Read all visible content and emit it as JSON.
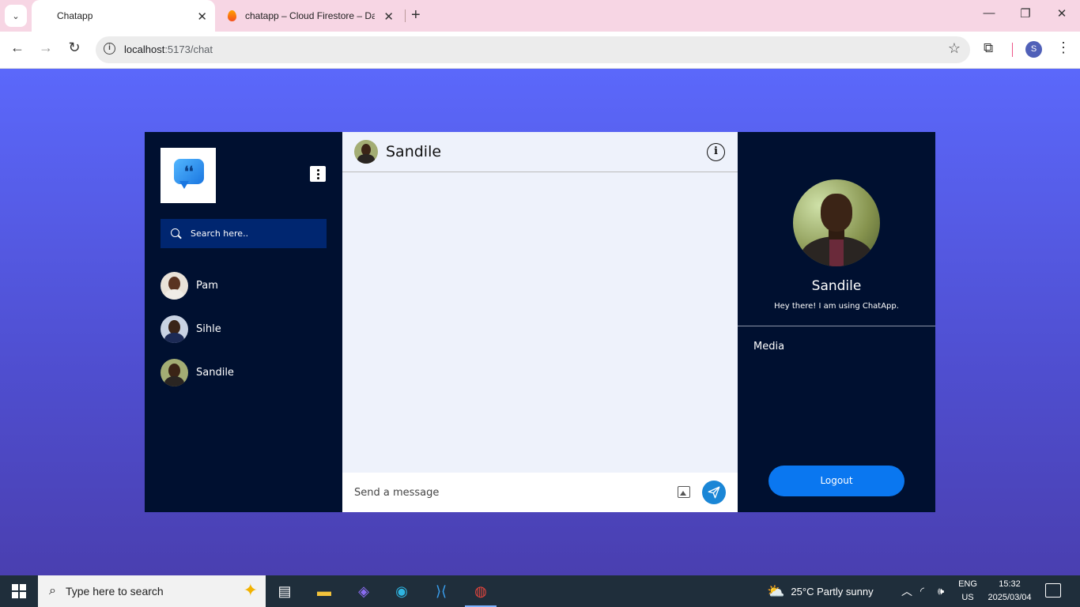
{
  "browser": {
    "tabs": [
      {
        "title": "Chatapp",
        "active": true
      },
      {
        "title": "chatapp – Cloud Firestore – Dat",
        "active": false
      }
    ],
    "url_host": "localhost",
    "url_port_path": ":5173/chat",
    "profile_initial": "S"
  },
  "sidebar": {
    "search_placeholder": "Search here..",
    "contacts": [
      {
        "name": "Pam"
      },
      {
        "name": "Sihle"
      },
      {
        "name": "Sandile"
      }
    ]
  },
  "chat": {
    "title": "Sandile",
    "message_placeholder": "Send a message"
  },
  "profile": {
    "name": "Sandile",
    "bio": "Hey there! I am using ChatApp.",
    "media_label": "Media",
    "logout_label": "Logout"
  },
  "taskbar": {
    "search_placeholder": "Type here to search",
    "weather": "25°C  Partly sunny",
    "lang_1": "ENG",
    "lang_2": "US",
    "time": "15:32",
    "date": "2025/03/04"
  },
  "colors": {
    "page_gradient_top": "#5b68fb",
    "panel_dark": "#001030",
    "search_bg": "#002670",
    "chat_bg": "#eef2fb",
    "send_button": "#1a86d6",
    "logout_button": "#0a77f0"
  }
}
